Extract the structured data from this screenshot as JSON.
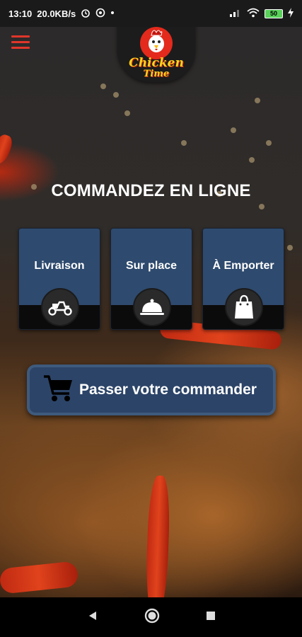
{
  "status_bar": {
    "time": "13:10",
    "network_speed": "20.0KB/s",
    "battery_level": "50",
    "icons": [
      "alarm-icon",
      "whatsapp-icon",
      "dot-icon",
      "signal-icon",
      "wifi-icon",
      "battery-icon",
      "charging-icon"
    ]
  },
  "header": {
    "menu_icon": "hamburger-menu-icon",
    "logo": {
      "name": "Chicken",
      "subname": "Time"
    }
  },
  "main": {
    "heading": "COMMANDEZ EN LIGNE",
    "options": [
      {
        "label": "Livraison",
        "icon": "scooter-icon"
      },
      {
        "label": "Sur place",
        "icon": "cloche-icon"
      },
      {
        "label": "À Emporter",
        "icon": "shopping-bag-icon"
      }
    ],
    "order_button": {
      "label": "Passer votre commander",
      "icon": "shopping-cart-icon"
    }
  },
  "nav_bar": {
    "buttons": [
      "back-icon",
      "home-icon",
      "recents-icon"
    ]
  },
  "colors": {
    "card": "#2e4a6e",
    "button": "#2c4468",
    "menu_icon": "#e0362a",
    "logo_text": "#ffd21c"
  }
}
